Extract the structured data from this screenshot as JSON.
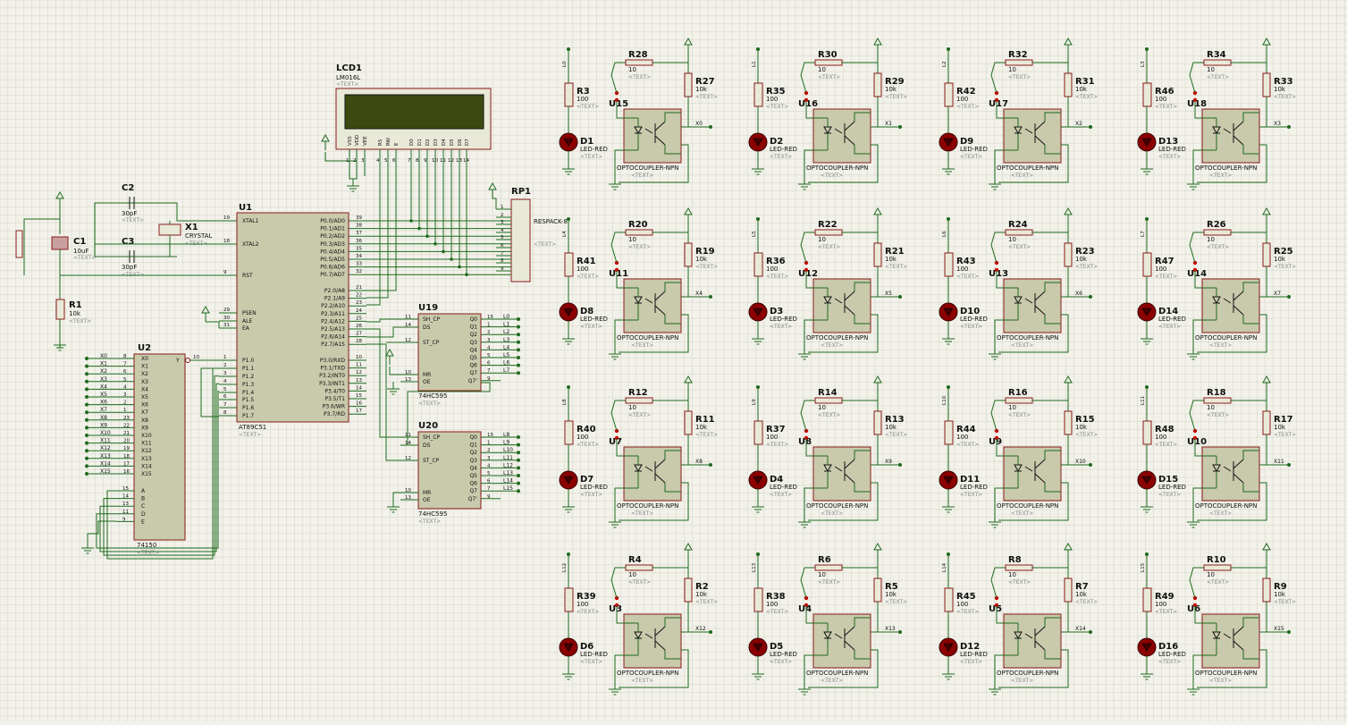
{
  "lcd": {
    "ref": "LCD1",
    "value": "LM016L",
    "text": "<TEXT>",
    "pins": [
      "VSS",
      "VDD",
      "VEE",
      "RS",
      "RW",
      "E",
      "D0",
      "D1",
      "D2",
      "D3",
      "D4",
      "D5",
      "D6",
      "D7"
    ],
    "pin_numbers": [
      "1",
      "2",
      "3",
      "4",
      "5",
      "6",
      "7",
      "8",
      "9",
      "10",
      "11",
      "12",
      "13",
      "14"
    ]
  },
  "mcu": {
    "ref": "U1",
    "value": "AT89C51",
    "text": "<TEXT>",
    "left_pins": [
      {
        "n": "19",
        "name": "XTAL1"
      },
      {
        "n": "18",
        "name": "XTAL2"
      },
      {
        "n": "9",
        "name": "RST"
      },
      {
        "n": "29",
        "name": "PSEN"
      },
      {
        "n": "30",
        "name": "ALE"
      },
      {
        "n": "31",
        "name": "EA"
      },
      {
        "n": "1",
        "name": "P1.0"
      },
      {
        "n": "2",
        "name": "P1.1"
      },
      {
        "n": "3",
        "name": "P1.2"
      },
      {
        "n": "4",
        "name": "P1.3"
      },
      {
        "n": "5",
        "name": "P1.4"
      },
      {
        "n": "6",
        "name": "P1.5"
      },
      {
        "n": "7",
        "name": "P1.6"
      },
      {
        "n": "8",
        "name": "P1.7"
      }
    ],
    "right_pins": [
      {
        "n": "39",
        "name": "P0.0/AD0"
      },
      {
        "n": "38",
        "name": "P0.1/AD1"
      },
      {
        "n": "37",
        "name": "P0.2/AD2"
      },
      {
        "n": "36",
        "name": "P0.3/AD3"
      },
      {
        "n": "35",
        "name": "P0.4/AD4"
      },
      {
        "n": "34",
        "name": "P0.5/AD5"
      },
      {
        "n": "33",
        "name": "P0.6/AD6"
      },
      {
        "n": "32",
        "name": "P0.7/AD7"
      },
      {
        "n": "21",
        "name": "P2.0/A8"
      },
      {
        "n": "22",
        "name": "P2.1/A9"
      },
      {
        "n": "23",
        "name": "P2.2/A10"
      },
      {
        "n": "24",
        "name": "P2.3/A11"
      },
      {
        "n": "25",
        "name": "P2.4/A12"
      },
      {
        "n": "26",
        "name": "P2.5/A13"
      },
      {
        "n": "27",
        "name": "P2.6/A14"
      },
      {
        "n": "28",
        "name": "P2.7/A15"
      },
      {
        "n": "10",
        "name": "P3.0/RXD"
      },
      {
        "n": "11",
        "name": "P3.1/TXD"
      },
      {
        "n": "12",
        "name": "P3.2/INT0"
      },
      {
        "n": "13",
        "name": "P3.3/INT1"
      },
      {
        "n": "14",
        "name": "P3.4/T0"
      },
      {
        "n": "15",
        "name": "P3.5/T1"
      },
      {
        "n": "16",
        "name": "P3.6/WR"
      },
      {
        "n": "17",
        "name": "P3.7/RD"
      }
    ]
  },
  "respack": {
    "ref": "RP1",
    "value": "RESPACK-8",
    "text": "<TEXT>",
    "pins": [
      "1",
      "2",
      "3",
      "4",
      "5",
      "6",
      "7",
      "8",
      "9"
    ]
  },
  "crystal": {
    "ref": "X1",
    "value": "CRYSTAL",
    "text": "<TEXT>"
  },
  "caps": [
    {
      "ref": "C1",
      "value": "10uF",
      "text": "<TEXT>"
    },
    {
      "ref": "C2",
      "value": "30pF",
      "text": "<TEXT>"
    },
    {
      "ref": "C3",
      "value": "30pF",
      "text": "<TEXT>"
    }
  ],
  "r1": {
    "ref": "R1",
    "value": "10k",
    "text": "<TEXT>"
  },
  "shift_regs": [
    {
      "ref": "U19",
      "value": "74HC595",
      "text": "<TEXT>",
      "outs": [
        "L0",
        "L1",
        "L2",
        "L3",
        "L4",
        "L5",
        "L6",
        "L7"
      ]
    },
    {
      "ref": "U20",
      "value": "74HC595",
      "text": "<TEXT>",
      "outs": [
        "L8",
        "L9",
        "L10",
        "L11",
        "L12",
        "L13",
        "L14",
        "L15"
      ]
    }
  ],
  "sr_pins": {
    "left": [
      {
        "n": "11",
        "name": "SH_CP"
      },
      {
        "n": "14",
        "name": "DS"
      },
      {
        "n": "12",
        "name": "ST_CP"
      },
      {
        "n": "10",
        "name": "MR"
      },
      {
        "n": "13",
        "name": "OE"
      }
    ],
    "right": [
      {
        "n": "15",
        "name": "Q0"
      },
      {
        "n": "1",
        "name": "Q1"
      },
      {
        "n": "2",
        "name": "Q2"
      },
      {
        "n": "3",
        "name": "Q3"
      },
      {
        "n": "4",
        "name": "Q4"
      },
      {
        "n": "5",
        "name": "Q5"
      },
      {
        "n": "6",
        "name": "Q6"
      },
      {
        "n": "7",
        "name": "Q7"
      },
      {
        "n": "9",
        "name": "Q7'"
      }
    ]
  },
  "mux": {
    "ref": "U2",
    "value": "74150",
    "text": "<TEXT>",
    "out_name": "Y",
    "out_num": "10",
    "inputs": [
      {
        "n": "8",
        "name": "X0"
      },
      {
        "n": "7",
        "name": "X1"
      },
      {
        "n": "6",
        "name": "X2"
      },
      {
        "n": "5",
        "name": "X3"
      },
      {
        "n": "4",
        "name": "X4"
      },
      {
        "n": "3",
        "name": "X5"
      },
      {
        "n": "2",
        "name": "X6"
      },
      {
        "n": "1",
        "name": "X7"
      },
      {
        "n": "23",
        "name": "X8"
      },
      {
        "n": "22",
        "name": "X9"
      },
      {
        "n": "21",
        "name": "X10"
      },
      {
        "n": "20",
        "name": "X11"
      },
      {
        "n": "19",
        "name": "X12"
      },
      {
        "n": "18",
        "name": "X13"
      },
      {
        "n": "17",
        "name": "X14"
      },
      {
        "n": "16",
        "name": "X15"
      }
    ],
    "selects": [
      {
        "n": "15",
        "name": "A"
      },
      {
        "n": "14",
        "name": "B"
      },
      {
        "n": "13",
        "name": "C"
      },
      {
        "n": "11",
        "name": "D"
      },
      {
        "n": "9",
        "name": "E"
      }
    ]
  },
  "opto_cells": [
    {
      "u": "U15",
      "rin": "R3",
      "d": "D1",
      "rt": "R28",
      "rp": "R27",
      "x": "X0",
      "l": "L0"
    },
    {
      "u": "U16",
      "rin": "R35",
      "d": "D2",
      "rt": "R30",
      "rp": "R29",
      "x": "X1",
      "l": "L1"
    },
    {
      "u": "U17",
      "rin": "R42",
      "d": "D9",
      "rt": "R32",
      "rp": "R31",
      "x": "X2",
      "l": "L2"
    },
    {
      "u": "U18",
      "rin": "R46",
      "d": "D13",
      "rt": "R34",
      "rp": "R33",
      "x": "X3",
      "l": "L3"
    },
    {
      "u": "U11",
      "rin": "R41",
      "d": "D8",
      "rt": "R20",
      "rp": "R19",
      "x": "X4",
      "l": "L4"
    },
    {
      "u": "U12",
      "rin": "R36",
      "d": "D3",
      "rt": "R22",
      "rp": "R21",
      "x": "X5",
      "l": "L5"
    },
    {
      "u": "U13",
      "rin": "R43",
      "d": "D10",
      "rt": "R24",
      "rp": "R23",
      "x": "X6",
      "l": "L6"
    },
    {
      "u": "U14",
      "rin": "R47",
      "d": "D14",
      "rt": "R26",
      "rp": "R25",
      "x": "X7",
      "l": "L7"
    },
    {
      "u": "U7",
      "rin": "R40",
      "d": "D7",
      "rt": "R12",
      "rp": "R11",
      "x": "X8",
      "l": "L8"
    },
    {
      "u": "U8",
      "rin": "R37",
      "d": "D4",
      "rt": "R14",
      "rp": "R13",
      "x": "X9",
      "l": "L9"
    },
    {
      "u": "U9",
      "rin": "R44",
      "d": "D11",
      "rt": "R16",
      "rp": "R15",
      "x": "X10",
      "l": "L10"
    },
    {
      "u": "U10",
      "rin": "R48",
      "d": "D15",
      "rt": "R18",
      "rp": "R17",
      "x": "X11",
      "l": "L11"
    },
    {
      "u": "U3",
      "rin": "R39",
      "d": "D6",
      "rt": "R4",
      "rp": "R2",
      "x": "X12",
      "l": "L12"
    },
    {
      "u": "U4",
      "rin": "R38",
      "d": "D5",
      "rt": "R6",
      "rp": "R5",
      "x": "X13",
      "l": "L13"
    },
    {
      "u": "U5",
      "rin": "R45",
      "d": "D12",
      "rt": "R8",
      "rp": "R7",
      "x": "X14",
      "l": "L14"
    },
    {
      "u": "U6",
      "rin": "R49",
      "d": "D16",
      "rt": "R10",
      "rp": "R9",
      "x": "X15",
      "l": "L15"
    }
  ],
  "opto_values": {
    "rin": "100",
    "rt": "10",
    "rp": "10k",
    "led": "LED-RED",
    "opto": "OPTOCOUPLER-NPN",
    "text": "<TEXT>"
  },
  "colors": {
    "background": "#f2f2ea",
    "grid": "#d2d2c8",
    "wire": "#1e6a1e",
    "outline": "#8b1a1a",
    "body": "#c9c9ac",
    "lcd_screen": "#3c4a12",
    "led": "#8b0000"
  }
}
